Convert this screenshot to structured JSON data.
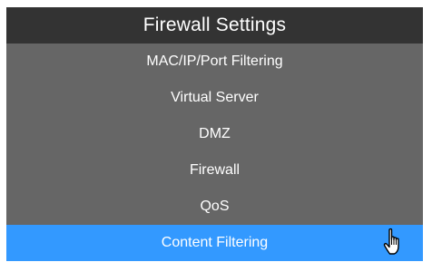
{
  "menu": {
    "title": "Firewall Settings",
    "items": [
      {
        "label": "MAC/IP/Port Filtering"
      },
      {
        "label": "Virtual Server"
      },
      {
        "label": "DMZ"
      },
      {
        "label": "Firewall"
      },
      {
        "label": "QoS"
      },
      {
        "label": "Content Filtering",
        "active": true
      }
    ]
  },
  "cursor": {
    "icon": "hand-pointer-icon"
  },
  "colors": {
    "header_bg": "#333333",
    "menu_bg": "#666666",
    "active_bg": "#3399ff",
    "text": "#ffffff"
  }
}
